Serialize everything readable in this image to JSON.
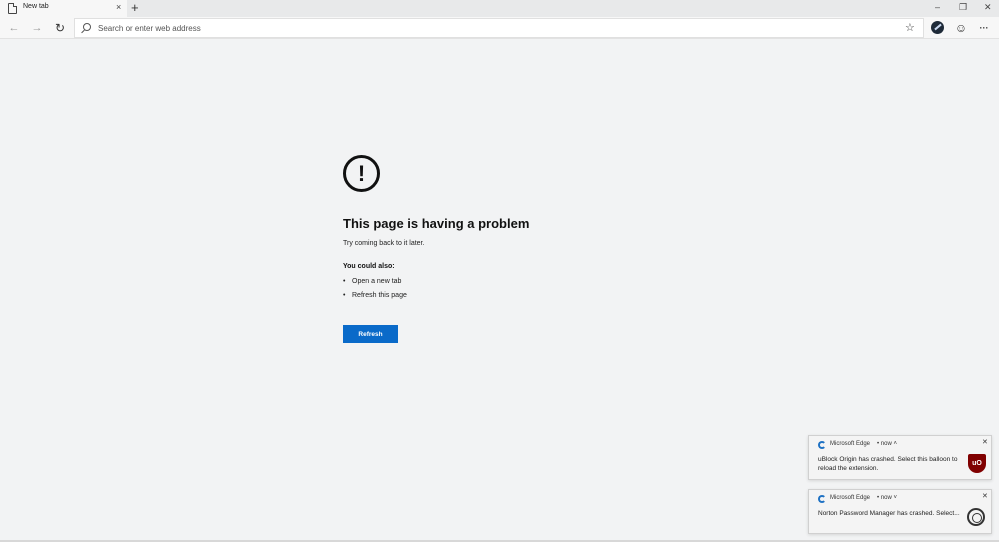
{
  "tab": {
    "title": "New tab",
    "close": "×",
    "new": "+"
  },
  "window_controls": {
    "minimize": "–",
    "restore": "❐",
    "close": "✕"
  },
  "toolbar": {
    "back": "←",
    "forward": "→",
    "refresh": "↻",
    "address_placeholder": "Search or enter web address",
    "favorite": "☆",
    "feedback": "☺",
    "more": "···"
  },
  "error": {
    "icon": "!",
    "title": "This page is having a problem",
    "subtitle": "Try coming back to it later.",
    "also_heading": "You could also:",
    "options": [
      "Open a new tab",
      "Refresh this page"
    ],
    "button_label": "Refresh"
  },
  "notifications": [
    {
      "app": "Microsoft Edge",
      "meta": "• now ˄",
      "message": "uBlock Origin has crashed. Select this balloon to reload the extension.",
      "icon_label": "uO",
      "close": "✕"
    },
    {
      "app": "Microsoft Edge",
      "meta": "• now ˅",
      "message": "Norton Password Manager has crashed. Select...",
      "close": "✕"
    }
  ],
  "colors": {
    "accent": "#0a6ac9",
    "background": "#f2f3f4",
    "edge_blue": "#1f72c4",
    "ublock_red": "#800000"
  }
}
